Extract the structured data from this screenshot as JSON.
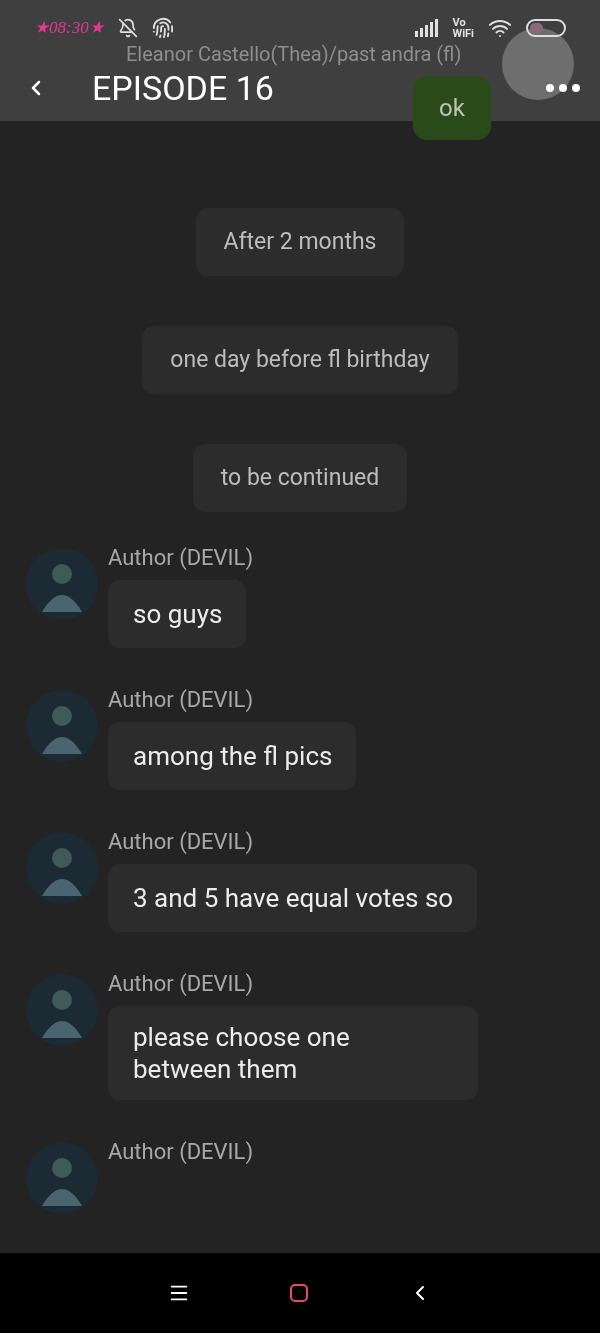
{
  "status_bar": {
    "time": "★08:30★",
    "vowifi": [
      "Vo",
      "WiFi"
    ]
  },
  "header": {
    "title": "EPISODE 16"
  },
  "behind_header": {
    "sender": "Eleanor Castello(Thea)/past andra (fl)",
    "message": "ok"
  },
  "narrations": [
    "After 2 months",
    "one day before fl birthday",
    "to be continued"
  ],
  "messages": [
    {
      "sender": "Author (DEVIL)",
      "text": "so guys"
    },
    {
      "sender": "Author (DEVIL)",
      "text": "among the fl pics"
    },
    {
      "sender": "Author (DEVIL)",
      "text": "3 and 5 have equal votes so"
    },
    {
      "sender": "Author (DEVIL)",
      "text": "please choose one between them"
    },
    {
      "sender": "Author (DEVIL)"
    }
  ]
}
